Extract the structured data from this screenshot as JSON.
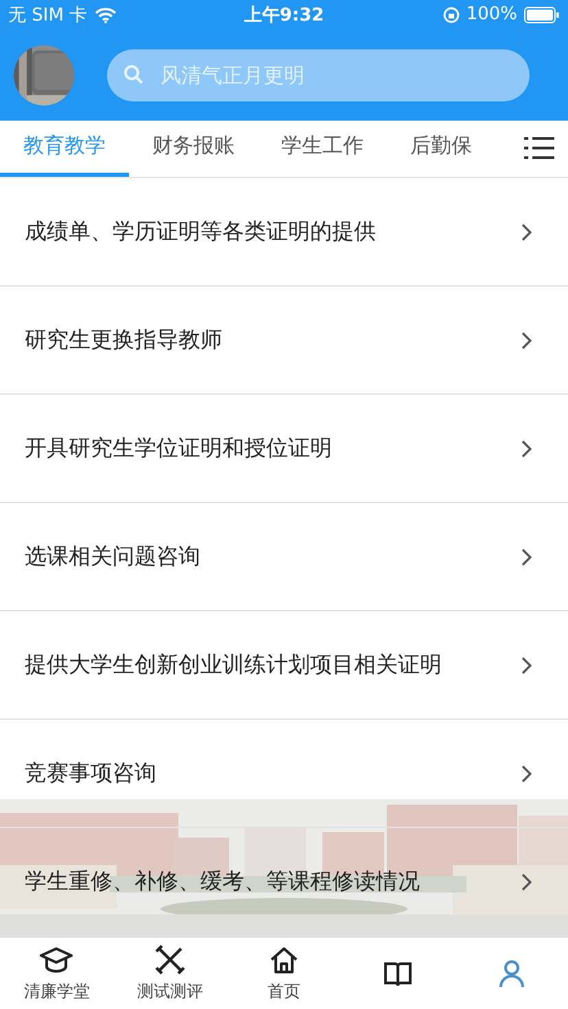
{
  "status_bar": {
    "carrier": "无 SIM 卡",
    "time": "上午9:32",
    "battery": "100%"
  },
  "header": {
    "search": {
      "placeholder": "风清气正月更明"
    }
  },
  "tabs": [
    {
      "label": "教育教学",
      "selected": true
    },
    {
      "label": "财务报账",
      "selected": false
    },
    {
      "label": "学生工作",
      "selected": false
    },
    {
      "label": "后勤保",
      "selected": false
    }
  ],
  "items": [
    {
      "title": "成绩单、学历证明等各类证明的提供"
    },
    {
      "title": "研究生更换指导教师"
    },
    {
      "title": "开具研究生学位证明和授位证明"
    },
    {
      "title": "选课相关问题咨询"
    },
    {
      "title": "提供大学生创新创业训练计划项目相关证明"
    },
    {
      "title": "竞赛事项咨询"
    },
    {
      "title": "学生重修、补修、缓考、等课程修读情况"
    }
  ],
  "bottom_nav": [
    {
      "kind": "cap",
      "label": "清廉学堂"
    },
    {
      "kind": "tools",
      "label": "测试测评"
    },
    {
      "kind": "home",
      "label": "首页"
    },
    {
      "kind": "book"
    },
    {
      "kind": "person"
    }
  ]
}
